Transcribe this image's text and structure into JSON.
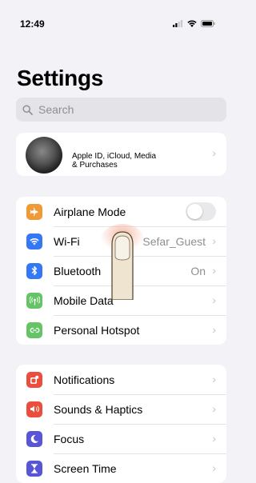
{
  "status_bar": {
    "time": "12:49"
  },
  "page": {
    "title": "Settings"
  },
  "search": {
    "placeholder": "Search"
  },
  "profile": {
    "subtitle_line1": "Apple ID, iCloud, Media",
    "subtitle_line2": "& Purchases"
  },
  "connectivity": {
    "items": [
      {
        "label": "Airplane Mode",
        "value": "",
        "toggle": "off",
        "icon": "airplane-icon",
        "color": "#f09a37"
      },
      {
        "label": "Wi-Fi",
        "value": "Sefar_Guest",
        "icon": "wifi-icon",
        "color": "#3478f6"
      },
      {
        "label": "Bluetooth",
        "value": "On",
        "icon": "bluetooth-icon",
        "color": "#3478f6"
      },
      {
        "label": "Mobile Data",
        "value": "",
        "icon": "antenna-icon",
        "color": "#65c466"
      },
      {
        "label": "Personal Hotspot",
        "value": "",
        "icon": "hotspot-icon",
        "color": "#65c466"
      }
    ]
  },
  "notifications_group": {
    "items": [
      {
        "label": "Notifications",
        "icon": "notifications-icon",
        "color": "#eb4e3d"
      },
      {
        "label": "Sounds & Haptics",
        "icon": "speaker-icon",
        "color": "#eb4e3d"
      },
      {
        "label": "Focus",
        "icon": "moon-icon",
        "color": "#5856d6"
      },
      {
        "label": "Screen Time",
        "icon": "hourglass-icon",
        "color": "#5856d6"
      }
    ]
  },
  "chevron": "›"
}
